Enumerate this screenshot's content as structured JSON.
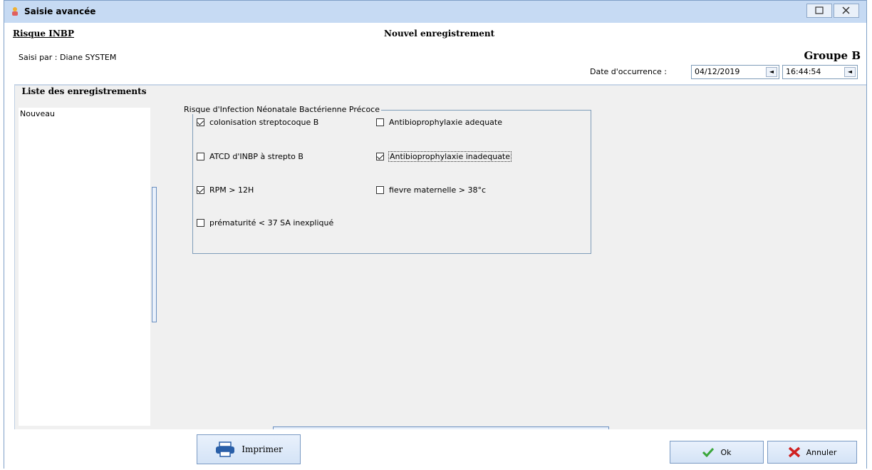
{
  "window": {
    "title": "Saisie avancée"
  },
  "header": {
    "risk_title": "Risque INBP",
    "record_title": "Nouvel enregistrement",
    "saisi_par": "Saisi par  : Diane SYSTEM",
    "groupe": "Groupe B",
    "date_label": "Date d'occurrence :",
    "date_value": "04/12/2019",
    "time_value": "16:44:54"
  },
  "list": {
    "heading": "Liste des enregistrements",
    "items": [
      "Nouveau"
    ]
  },
  "group": {
    "legend": "Risque d'Infection Néonatale Bactérienne Précoce",
    "items": [
      {
        "label": "colonisation streptocoque B",
        "checked": true
      },
      {
        "label": "Antibioprophylaxie adequate",
        "checked": false
      },
      {
        "label": "ATCD d'INBP à strepto B",
        "checked": false
      },
      {
        "label": "Antibioprophylaxie inadequate",
        "checked": true
      },
      {
        "label": "RPM > 12H",
        "checked": true
      },
      {
        "label": "fievre maternelle > 38°c",
        "checked": false
      },
      {
        "label": "prématurité < 37 SA inexpliqué",
        "checked": false
      }
    ]
  },
  "footer": {
    "print_label": "Imprimer",
    "ok_label": "Ok",
    "cancel_label": "Annuler"
  },
  "colors": {
    "titlebar": "#c6daf3",
    "ok_check": "#3aa63a",
    "cancel_x": "#d02020",
    "printer": "#2a5fa8"
  }
}
